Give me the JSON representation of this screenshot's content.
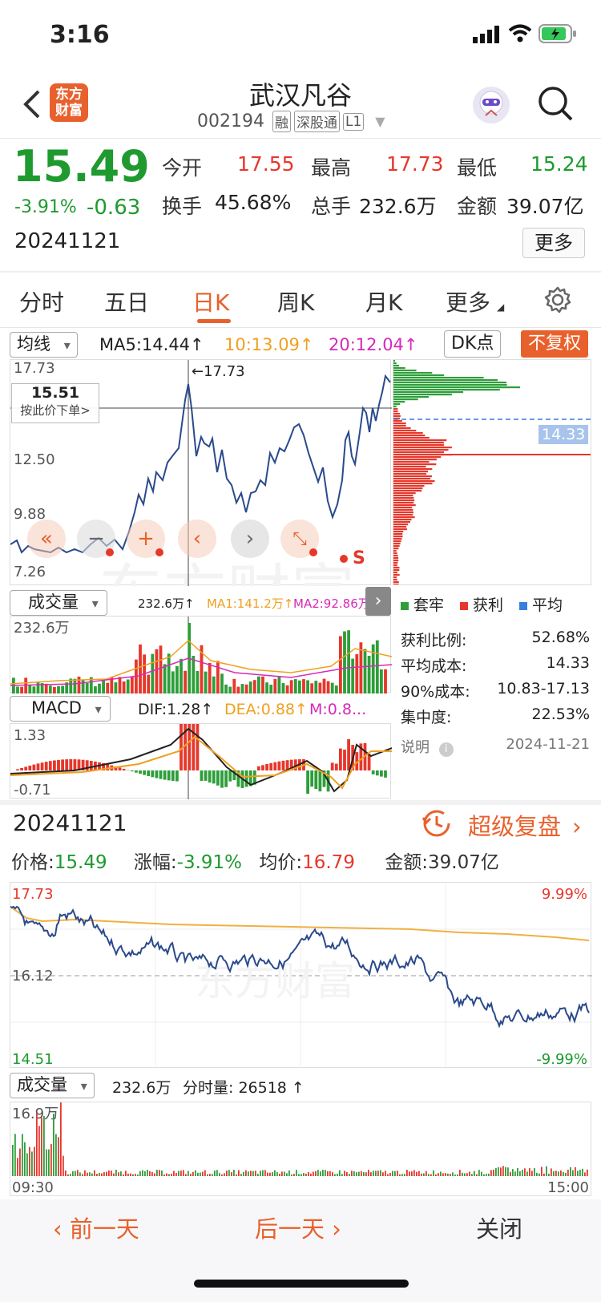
{
  "status_bar": {
    "time": "3:16"
  },
  "header": {
    "logo_line1": "东方",
    "logo_line2": "财富",
    "stock_name": "武汉凡谷",
    "stock_code": "002194",
    "tag_rong": "融",
    "tag_sgt": "深股通",
    "tag_level": "L1"
  },
  "quote": {
    "price": "15.49",
    "change_pct": "-3.91%",
    "change": "-0.63",
    "date": "20241121",
    "open_label": "今开",
    "open_value": "17.55",
    "high_label": "最高",
    "high_value": "17.73",
    "low_label": "最低",
    "low_value": "15.24",
    "turnover_label": "换手",
    "turnover_value": "45.68%",
    "volume_label": "总手",
    "volume_value": "232.6万",
    "amount_label": "金额",
    "amount_value": "39.07亿",
    "more_button": "更多"
  },
  "tabs": [
    "分时",
    "五日",
    "日K",
    "周K",
    "月K",
    "更多"
  ],
  "active_tab": "日K",
  "kline": {
    "ma_selector": "均线",
    "ma5": "MA5:14.44↑",
    "ma10": "10:13.09↑",
    "ma20": "20:12.04↑",
    "dk_button": "DK点",
    "fq_button": "不复权",
    "y_labels": [
      "17.73",
      "12.50",
      "9.88",
      "7.26"
    ],
    "high_marker": "←17.73",
    "cursor_price": "15.51",
    "cursor_action": "按此价下单>",
    "chip_avg_cost": "14.33",
    "ctrl_s": "S"
  },
  "volume_panel": {
    "selector": "成交量",
    "vol": "232.6万↑",
    "ma1": "MA1:141.2万↑",
    "ma2": "MA2:92.86万↑",
    "y_label": "232.6万"
  },
  "macd_panel": {
    "selector": "MACD",
    "dif": "DIF:1.28↑",
    "dea": "DEA:0.88↑",
    "m": "M:0.8...",
    "y_top": "1.33",
    "y_bottom": "-0.71"
  },
  "chips": {
    "legend_trapped": "套牢",
    "legend_profit": "获利",
    "legend_avg": "平均",
    "profit_ratio_label": "获利比例:",
    "profit_ratio_value": "52.68%",
    "avg_cost_label": "平均成本:",
    "avg_cost_value": "14.33",
    "cost90_label": "90%成本:",
    "cost90_value": "10.83-17.13",
    "concentration_label": "集中度:",
    "concentration_value": "22.53%",
    "note_label": "说明",
    "note_date": "2024-11-21"
  },
  "intraday": {
    "date": "20241121",
    "replay_label": "超级复盘",
    "price_label": "价格:",
    "price_value": "15.49",
    "chg_label": "涨幅:",
    "chg_value": "-3.91%",
    "avg_label": "均价:",
    "avg_value": "16.79",
    "amount_label": "金额:",
    "amount_value": "39.07亿",
    "y_top": "17.73",
    "y_mid": "16.12",
    "y_bottom": "14.51",
    "pct_top": "9.99%",
    "pct_bottom": "-9.99%",
    "watermark": "东方财富",
    "vol_selector": "成交量",
    "vol_total": "232.6万",
    "vol_minute": "分时量: 26518 ↑",
    "vol_y": "16.9万",
    "time_start": "09:30",
    "time_end": "15:00"
  },
  "bottom_nav": {
    "prev": "前一天",
    "next": "后一天",
    "close": "关闭"
  },
  "colors": {
    "up": "#e6372b",
    "down": "#1e9a2f",
    "price_line": "#2b4a8c",
    "ma_orange": "#f0a020",
    "ma_magenta": "#d62ab8",
    "accent": "#e8612c"
  }
}
